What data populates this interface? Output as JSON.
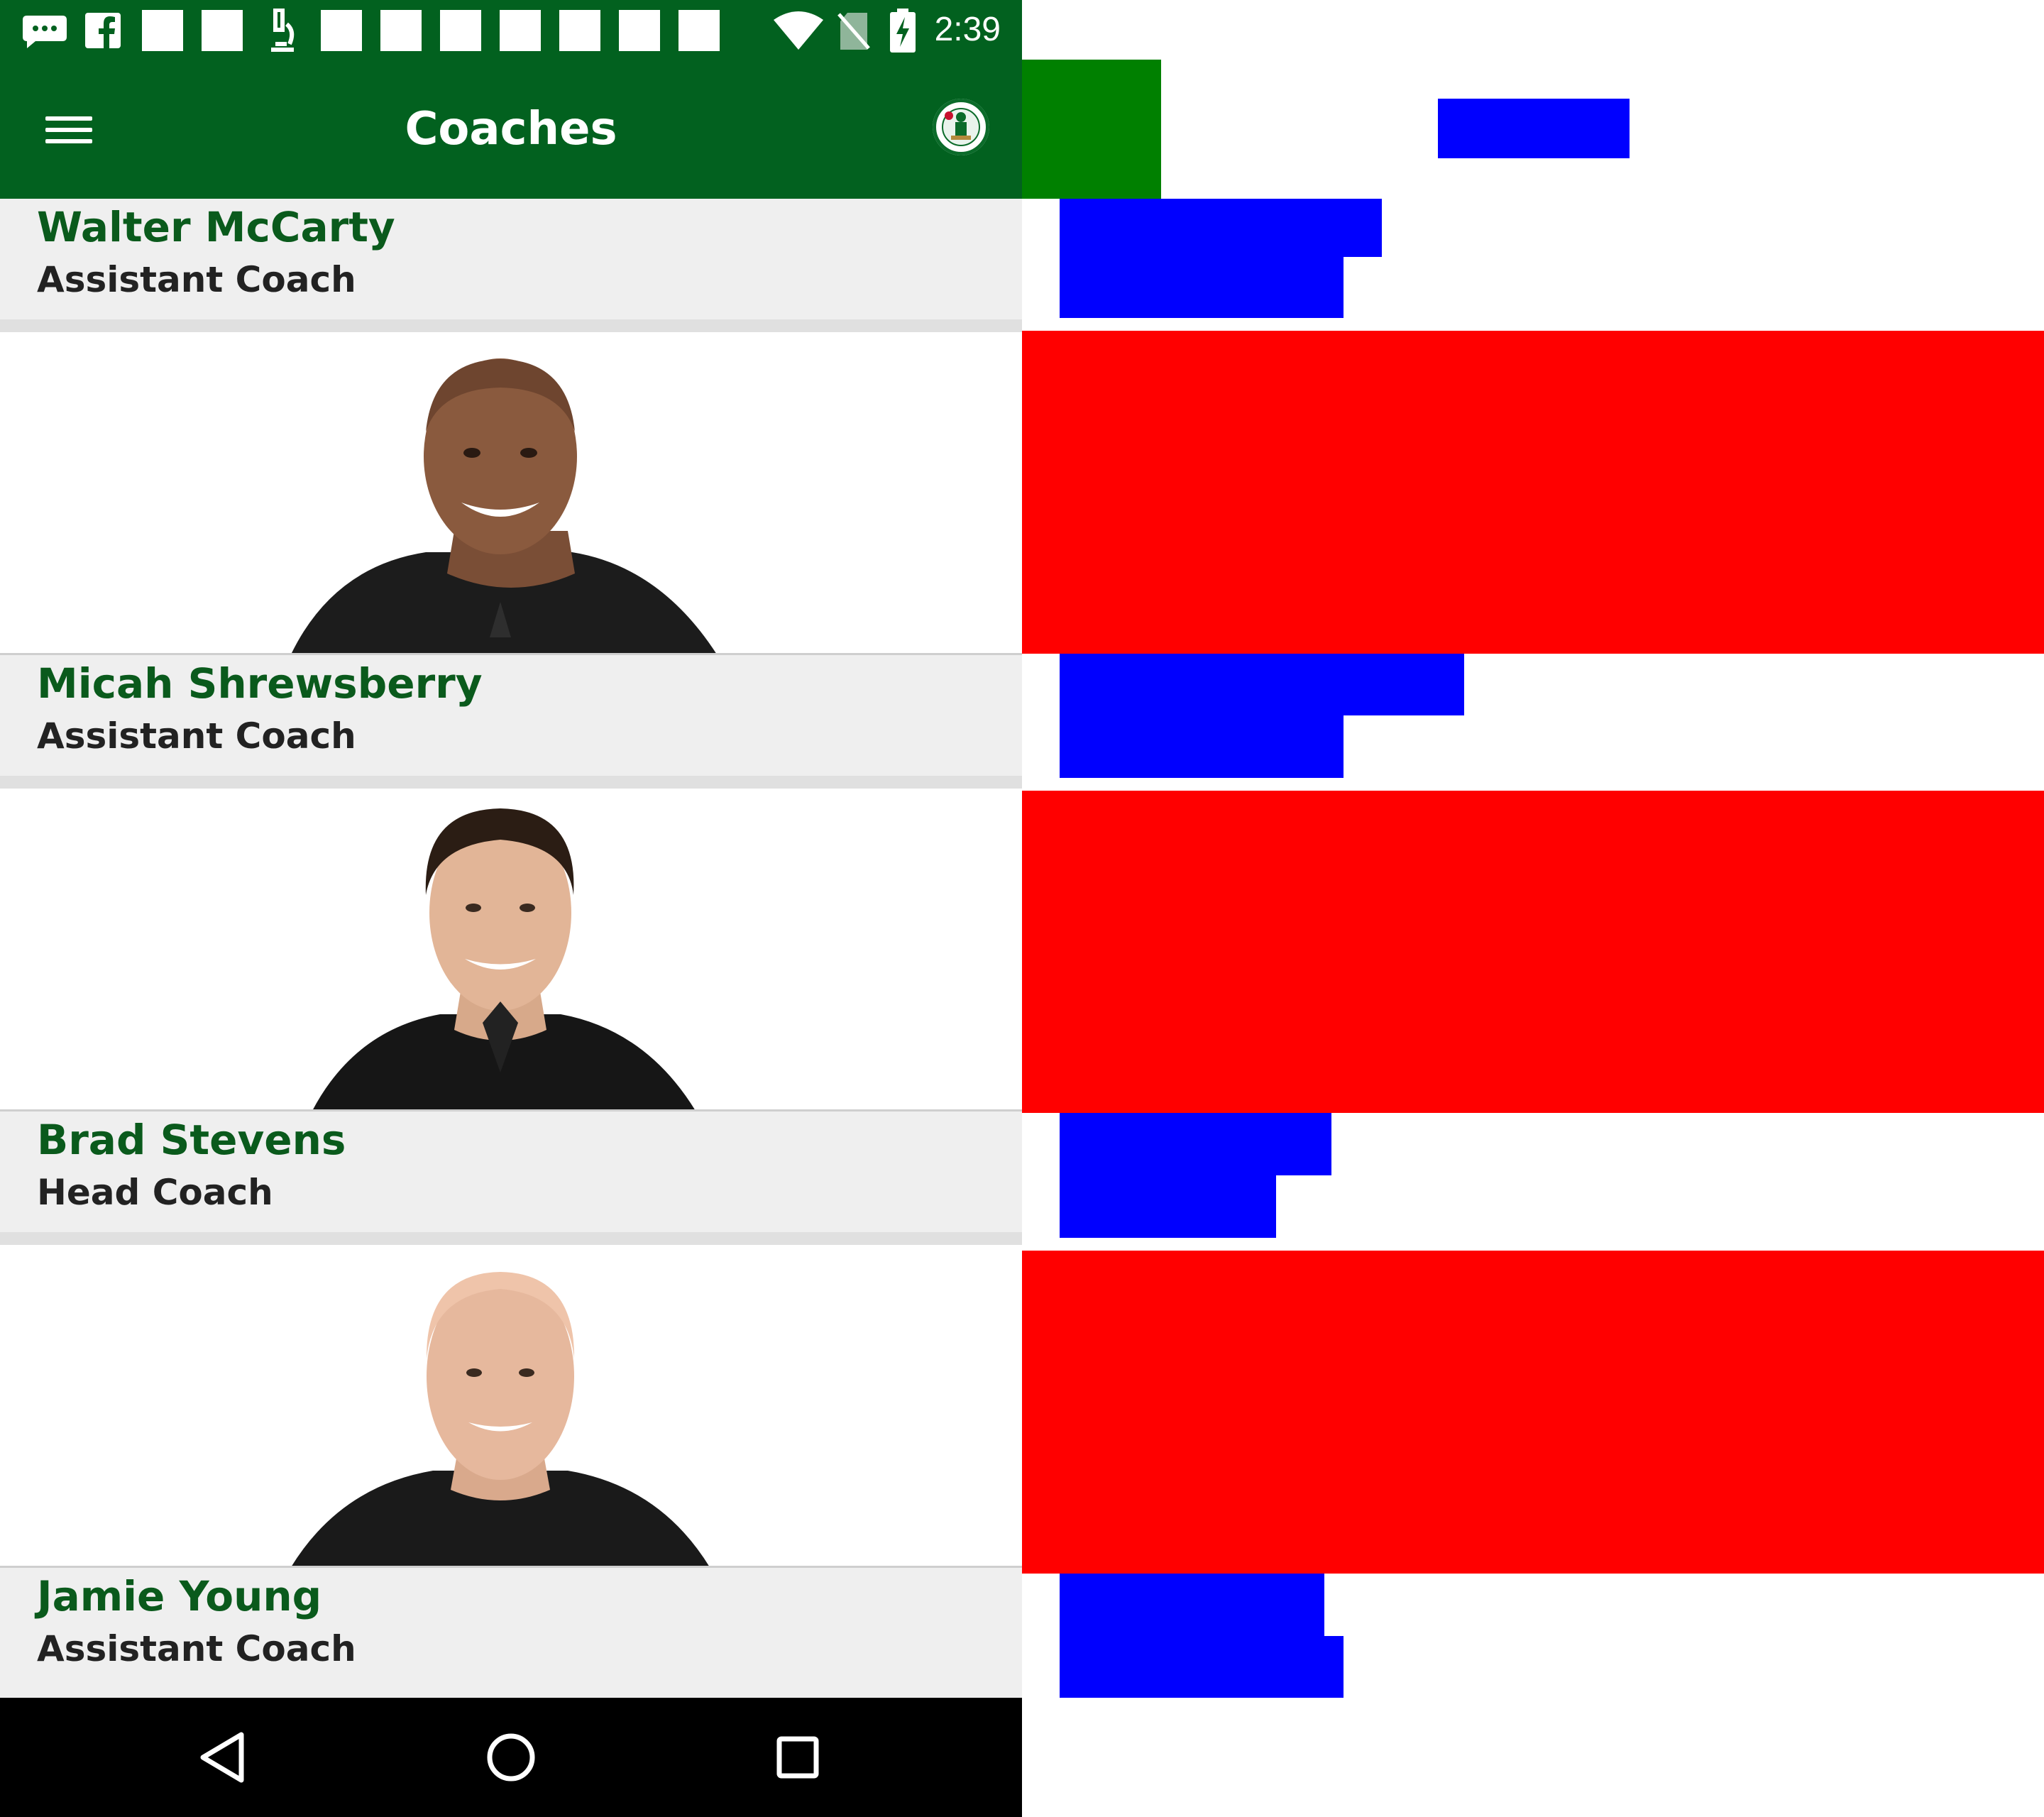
{
  "status_bar": {
    "time": "2:39",
    "icons": [
      "message-icon",
      "facebook-icon",
      "notification-square",
      "notification-square",
      "microscope-icon",
      "notification-square",
      "notification-square",
      "notification-square",
      "notification-square",
      "notification-square",
      "notification-square",
      "notification-square",
      "wifi-icon",
      "no-sim-icon",
      "battery-charging-icon"
    ]
  },
  "app_bar": {
    "title": "Coaches",
    "menu_icon": "hamburger-menu-icon",
    "logo_icon": "celtics-logo"
  },
  "coaches": [
    {
      "name": "Walter McCarty",
      "title": "Assistant Coach"
    },
    {
      "name": "Micah Shrewsberry",
      "title": "Assistant Coach"
    },
    {
      "name": "Brad Stevens",
      "title": "Head Coach"
    },
    {
      "name": "Jamie Young",
      "title": "Assistant Coach"
    }
  ],
  "nav_bar": {
    "back_icon": "back-triangle-icon",
    "home_icon": "home-circle-icon",
    "recents_icon": "recents-square-icon"
  },
  "colors": {
    "brand_green": "#02611f",
    "name_green": "#0a5a1c",
    "band_gray": "#efefef",
    "debug_green": "#008000",
    "debug_blue": "#0000ff",
    "debug_red": "#ff0000"
  }
}
